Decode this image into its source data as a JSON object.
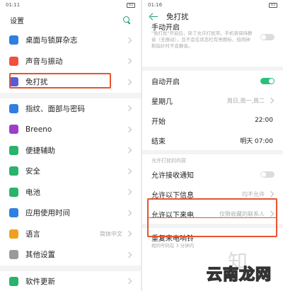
{
  "left": {
    "status": {
      "time": "01:11",
      "battery": "83"
    },
    "header": {
      "title": "设置"
    },
    "groups": [
      [
        {
          "name": "wallpaper",
          "label": "桌面与锁屏杂志",
          "icon": "wallpaper-icon",
          "color": "#2f7fe0"
        },
        {
          "name": "sound",
          "label": "声音与振动",
          "icon": "speaker-icon",
          "color": "#f0503c"
        },
        {
          "name": "dnd",
          "label": "免打扰",
          "icon": "moon-icon",
          "color": "#5b5bd6"
        }
      ],
      [
        {
          "name": "fingerprint",
          "label": "指纹、面部与密码",
          "icon": "fingerprint-icon",
          "color": "#2f7fe0"
        },
        {
          "name": "breeno",
          "label": "Breeno",
          "icon": "breeno-icon",
          "color": "#9b3fc9"
        },
        {
          "name": "accessibility",
          "label": "便捷辅助",
          "icon": "hand-icon",
          "color": "#29b36b"
        },
        {
          "name": "security",
          "label": "安全",
          "icon": "shield-icon",
          "color": "#29b36b"
        },
        {
          "name": "battery",
          "label": "电池",
          "icon": "battery-icon",
          "color": "#29b36b"
        },
        {
          "name": "app-usage",
          "label": "应用使用时间",
          "icon": "hourglass-icon",
          "color": "#2f7fe0"
        },
        {
          "name": "language",
          "label": "语言",
          "value": "简体中文",
          "icon": "language-icon",
          "color": "#f0a020"
        },
        {
          "name": "other",
          "label": "其他设置",
          "icon": "gear-icon",
          "color": "#9a9a9a"
        }
      ],
      [
        {
          "name": "software-update",
          "label": "软件更新",
          "icon": "update-icon",
          "color": "#29b36b"
        }
      ]
    ]
  },
  "right": {
    "status": {
      "time": "01:16",
      "battery": "83"
    },
    "header": {
      "title": "免打扰"
    },
    "manual": {
      "label": "手动开启",
      "desc": "\"免打扰\"开启后，除了允许打扰项，手机将保持静音（无振动），且不会在状态栏有亮图标、但闹钟和指针时不会静音。"
    },
    "auto_on": {
      "label": "自动开启"
    },
    "weekday": {
      "label": "星期几",
      "value": "周日,周一,周二"
    },
    "start": {
      "label": "开始",
      "value": "22:00"
    },
    "end": {
      "label": "结束",
      "value": "明天 07:00"
    },
    "section": "允许打扰的内容",
    "allow_notification": {
      "label": "允许接收通知"
    },
    "allow_messages": {
      "label": "允许以下信息",
      "value": "均不允许"
    },
    "allow_calls": {
      "label": "允许以下来电",
      "value": "仅限收藏的联系人"
    },
    "repeat_call": {
      "label": "重复来电响铃",
      "desc": "相同号码在 3 分钟内"
    }
  },
  "watermarks": {
    "zhi": "知",
    "brand": "云南龙网"
  },
  "colors": {
    "accent": "#1aa06a",
    "highlight": "#e8542d"
  }
}
